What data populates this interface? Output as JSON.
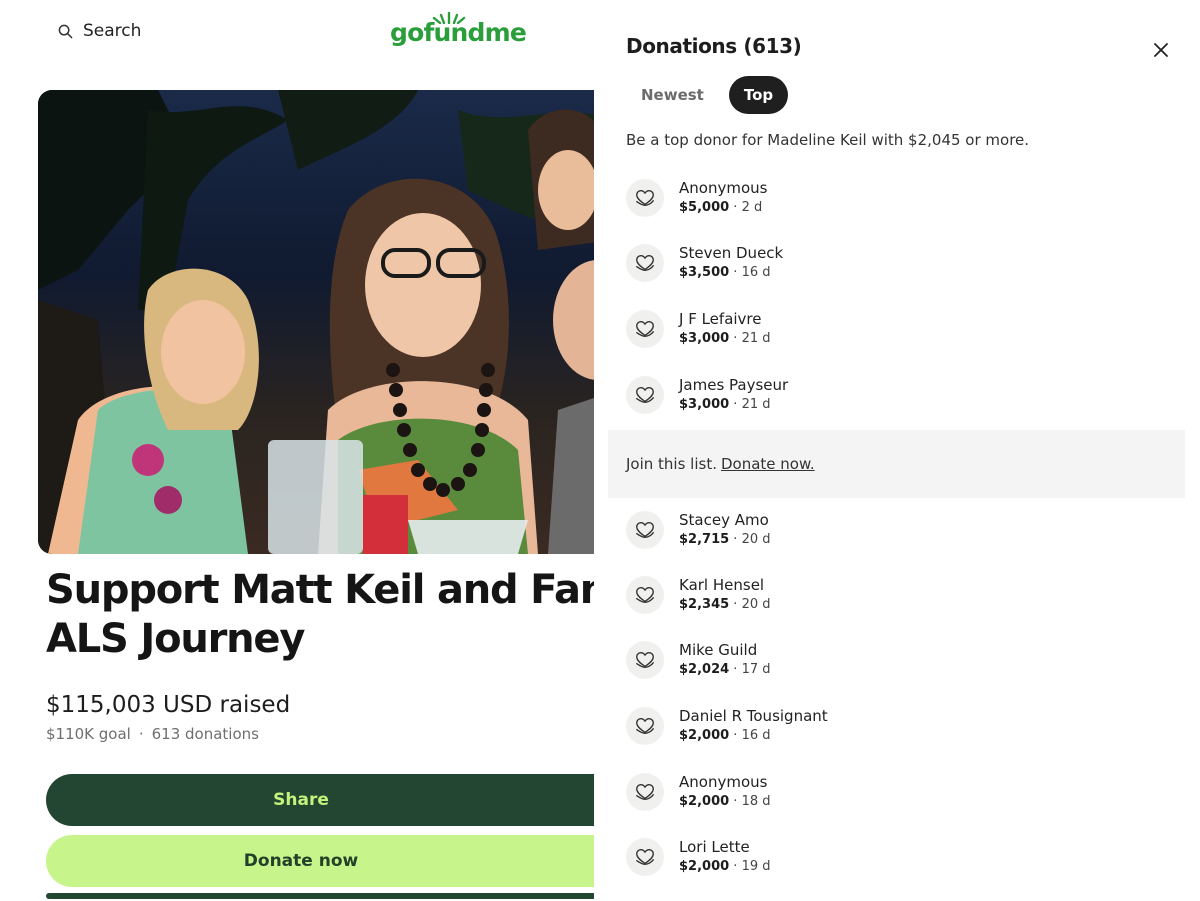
{
  "header": {
    "search_label": "Search",
    "logo_text": "gofundme",
    "brand_color": "#2b9e3c"
  },
  "campaign": {
    "title_line1": "Support Matt Keil and Family th",
    "title_line2": "ALS Journey",
    "raised": "$115,003 USD raised",
    "goal": "$110K goal",
    "separator": "·",
    "donations_count": "613 donations",
    "share_label": "Share",
    "donate_label": "Donate now"
  },
  "panel": {
    "title": "Donations (613)",
    "tabs": [
      {
        "label": "Newest",
        "active": false
      },
      {
        "label": "Top",
        "active": true
      }
    ],
    "hint": "Be a top donor for Madeline Keil with $2,045 or more.",
    "join_text": "Join this list.",
    "join_link": "Donate now.",
    "donors": [
      {
        "name": "Anonymous",
        "amount": "$5,000",
        "time": " · 2 d"
      },
      {
        "name": "Steven Dueck",
        "amount": "$3,500",
        "time": " · 16 d"
      },
      {
        "name": "J F Lefaivre",
        "amount": "$3,000",
        "time": " · 21 d"
      },
      {
        "name": "James Payseur",
        "amount": "$3,000",
        "time": " · 21 d"
      },
      {
        "name": "Stacey Amo",
        "amount": "$2,715",
        "time": " · 20 d"
      },
      {
        "name": "Karl Hensel",
        "amount": "$2,345",
        "time": " · 20 d"
      },
      {
        "name": "Mike Guild",
        "amount": "$2,024",
        "time": " · 17 d"
      },
      {
        "name": "Daniel R Tousignant",
        "amount": "$2,000",
        "time": " · 16 d"
      },
      {
        "name": "Anonymous",
        "amount": "$2,000",
        "time": " · 18 d"
      },
      {
        "name": "Lori Lette",
        "amount": "$2,000",
        "time": " · 19 d"
      }
    ]
  },
  "colors": {
    "dark_green": "#224631",
    "lime": "#c8f58b"
  }
}
